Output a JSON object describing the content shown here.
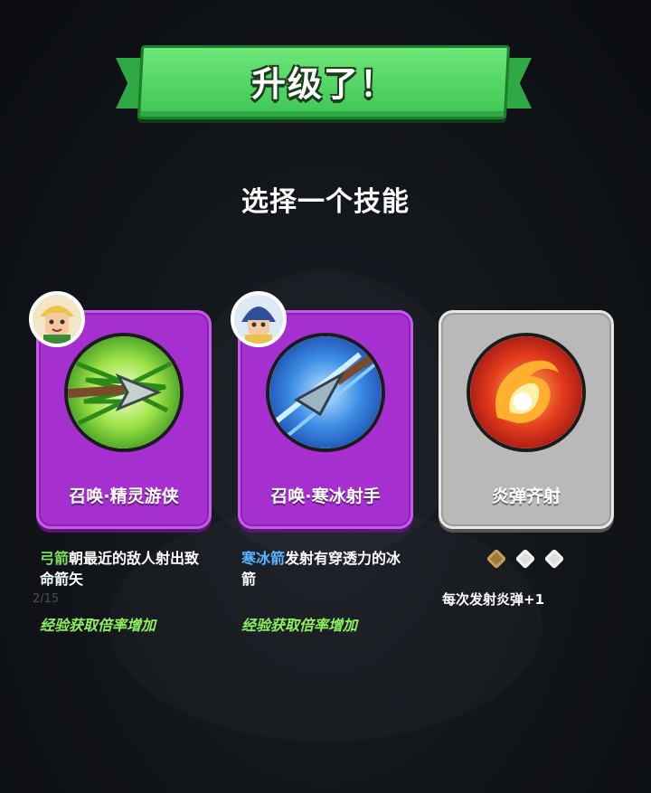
{
  "banner": {
    "title": "升级了！"
  },
  "subtitle": "选择一个技能",
  "cards": [
    {
      "name": "召唤·精灵游侠",
      "portrait": "elf-ranger-portrait",
      "icon": "green-arrow-icon",
      "desc_keyword": "弓箭",
      "desc_rest": "朝最近的敌人射出致命箭矢",
      "bonus": "经验获取倍率增加",
      "keyword_color": "#7fe05a"
    },
    {
      "name": "召唤·寒冰射手",
      "portrait": "ice-archer-portrait",
      "icon": "ice-arrow-icon",
      "desc_keyword": "寒冰箭",
      "desc_rest": "发射有穿透力的冰箭",
      "bonus": "经验获取倍率增加",
      "keyword_color": "#58b6ff"
    },
    {
      "name": "炎弹齐射",
      "icon": "fireball-icon",
      "desc_rest": "每次发射炎弹+1",
      "level": {
        "current": 1,
        "max": 3
      }
    }
  ],
  "background": {
    "progress_text": "2/15"
  },
  "colors": {
    "banner_green": "#4fd862",
    "card_purple": "#a62fd0",
    "card_gray": "#b9b9b9"
  }
}
